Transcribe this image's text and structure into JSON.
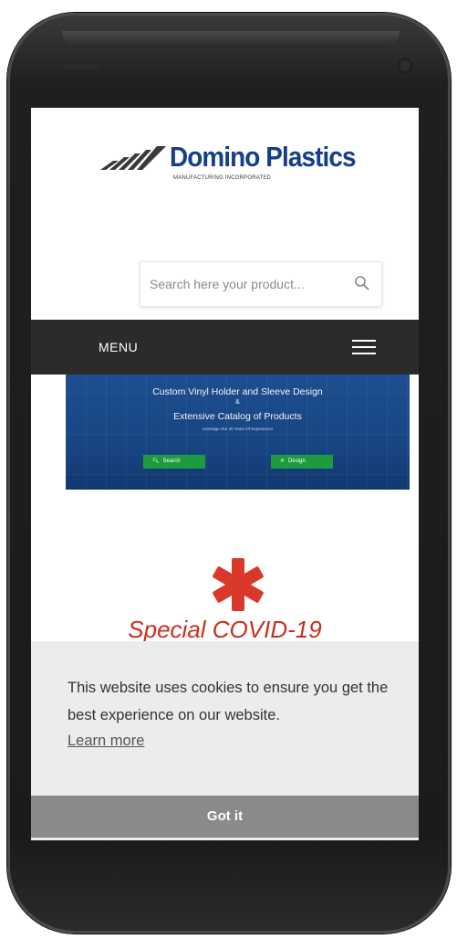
{
  "brand": {
    "name": "Domino Plastics",
    "tagline": "MANUFACTURING INCORPORATED",
    "color": "#163f88"
  },
  "search": {
    "placeholder": "Search here your product..."
  },
  "nav": {
    "menu_label": "MENU"
  },
  "banner": {
    "line1": "Custom Vinyl Holder and Sleeve Design",
    "amp": "&",
    "line2": "Extensive Catalog of Products",
    "tagline": "Leverage Our 40 Years Of Experience!",
    "search_button": "Search",
    "design_button": "Design",
    "button_color": "#1e9b3f"
  },
  "covid": {
    "title": "Special COVID-19",
    "accent": "#c8301f",
    "icon": "medical-asterisk-icon"
  },
  "cookie": {
    "message": "This website uses cookies to ensure you get the best experience on our website.",
    "learn_more": "Learn more",
    "accept": "Got it"
  }
}
